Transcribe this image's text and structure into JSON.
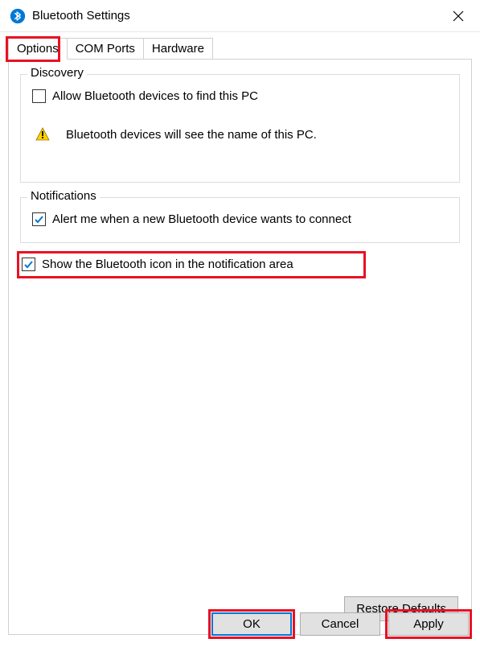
{
  "window": {
    "title": "Bluetooth Settings"
  },
  "tabs": {
    "options": "Options",
    "com_ports": "COM Ports",
    "hardware": "Hardware"
  },
  "discovery": {
    "group_label": "Discovery",
    "allow_find_label": "Allow Bluetooth devices to find this PC",
    "info_text": "Bluetooth devices will see the name of this PC."
  },
  "notifications": {
    "group_label": "Notifications",
    "alert_label": "Alert me when a new Bluetooth device wants to connect"
  },
  "show_icon_label": "Show the Bluetooth icon in the notification area",
  "buttons": {
    "restore": "Restore Defaults",
    "ok": "OK",
    "cancel": "Cancel",
    "apply": "Apply"
  }
}
